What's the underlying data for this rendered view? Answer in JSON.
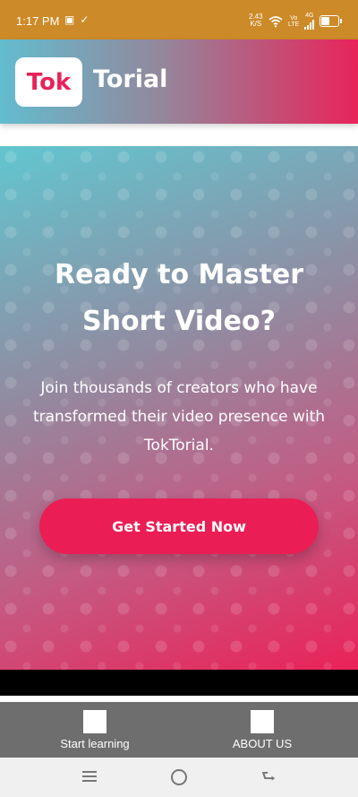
{
  "status_bar": {
    "time": "1:17 PM",
    "net_speed_value": "2.43",
    "net_speed_unit": "K/S",
    "volte_top": "Vo",
    "volte_bottom": "LTE",
    "network": "4G",
    "battery_level": 0.45
  },
  "header": {
    "logo_text": "Tok",
    "brand_text": "Torial",
    "accent_color": "#e8235a"
  },
  "hero": {
    "title": "Ready to Master Short Video?",
    "subtitle": "Join thousands of creators who have transformed their video presence with TokTorial.",
    "cta_label": "Get Started Now"
  },
  "bottom_nav": {
    "items": [
      {
        "label": "Start learning",
        "icon": "square-icon"
      },
      {
        "label": "ABOUT US",
        "icon": "square-icon"
      }
    ]
  },
  "system_nav": {
    "icons": [
      "menu-icon",
      "home-icon",
      "back-icon"
    ]
  }
}
